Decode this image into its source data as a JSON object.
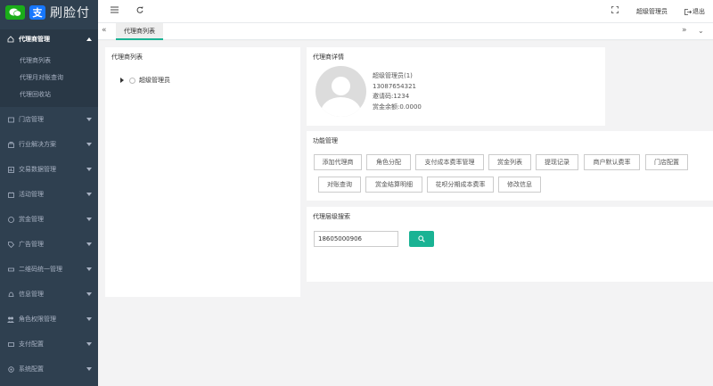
{
  "app": {
    "logo_text": "刷脸付",
    "logo_zfb_glyph": "支"
  },
  "sidebar": {
    "items": [
      {
        "label": "代理商管理",
        "icon": "home-icon",
        "expanded": true
      },
      {
        "label": "门店管理",
        "icon": "store-icon"
      },
      {
        "label": "行业解决方案",
        "icon": "industry-icon"
      },
      {
        "label": "交易数据管理",
        "icon": "chart-icon"
      },
      {
        "label": "活动管理",
        "icon": "activity-icon"
      },
      {
        "label": "赏金管理",
        "icon": "money-icon"
      },
      {
        "label": "广告管理",
        "icon": "tag-icon"
      },
      {
        "label": "二维码统一管理",
        "icon": "qrcode-icon"
      },
      {
        "label": "信息管理",
        "icon": "bell-icon"
      },
      {
        "label": "角色权限管理",
        "icon": "users-icon"
      },
      {
        "label": "支付配置",
        "icon": "card-icon"
      },
      {
        "label": "系统配置",
        "icon": "gear-icon"
      }
    ],
    "submenu": [
      "代理商列表",
      "代理月对账查询",
      "代理回收站"
    ]
  },
  "topbar": {
    "user_label": "超级管理员",
    "logout_label": "退出"
  },
  "tabs": {
    "active_label": "代理商列表"
  },
  "tree_panel": {
    "title": "代理商列表",
    "root_label": "超级管理员"
  },
  "detail_panel": {
    "title": "代理商详情",
    "name": "超级管理员(1)",
    "phone": "13087654321",
    "invite_code": "邀请码:1234",
    "balance": "赏金余额:0.0000"
  },
  "function_panel": {
    "title": "功能管理",
    "buttons_row1": [
      "添加代理商",
      "角色分配",
      "支付成本费率管理",
      "赏金列表",
      "提现记录",
      "商户默认费率",
      "门店配置"
    ],
    "buttons_row2": [
      "对账查询",
      "赏金结算明细",
      "花呗分期成本费率",
      "修改信息"
    ]
  },
  "search_panel": {
    "title": "代理层级搜索",
    "input_value": "18605000906"
  },
  "colors": {
    "sidebar_bg": "#2f4050",
    "accent": "#1ab394",
    "wechat_green": "#1aad19",
    "alipay_blue": "#1677ff"
  }
}
